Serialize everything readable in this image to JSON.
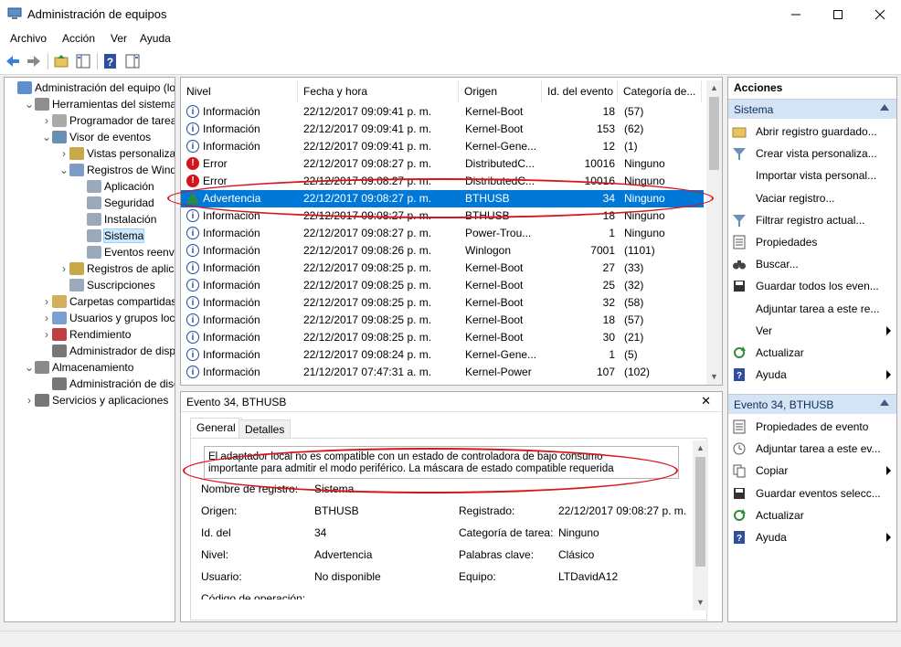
{
  "window": {
    "title": "Administración de equipos",
    "controls": [
      "minimize",
      "maximize",
      "close"
    ]
  },
  "menu": [
    "Archivo",
    "Acción",
    "Ver",
    "Ayuda"
  ],
  "tree": [
    {
      "label": "Administración del equipo (loc",
      "depth": 0,
      "exp": ""
    },
    {
      "label": "Herramientas del sistema",
      "depth": 1,
      "exp": "v"
    },
    {
      "label": "Programador de tareas",
      "depth": 2,
      "exp": ">"
    },
    {
      "label": "Visor de eventos",
      "depth": 2,
      "exp": "v"
    },
    {
      "label": "Vistas personalizada",
      "depth": 3,
      "exp": ">"
    },
    {
      "label": "Registros de Windov",
      "depth": 3,
      "exp": "v"
    },
    {
      "label": "Aplicación",
      "depth": 4,
      "exp": ""
    },
    {
      "label": "Seguridad",
      "depth": 4,
      "exp": ""
    },
    {
      "label": "Instalación",
      "depth": 4,
      "exp": ""
    },
    {
      "label": "Sistema",
      "depth": 4,
      "exp": "",
      "selected": true
    },
    {
      "label": "Eventos reenviac",
      "depth": 4,
      "exp": ""
    },
    {
      "label": "Registros de aplicac",
      "depth": 3,
      "exp": ">"
    },
    {
      "label": "Suscripciones",
      "depth": 3,
      "exp": ""
    },
    {
      "label": "Carpetas compartidas",
      "depth": 2,
      "exp": ">"
    },
    {
      "label": "Usuarios y grupos locale",
      "depth": 2,
      "exp": ">"
    },
    {
      "label": "Rendimiento",
      "depth": 2,
      "exp": ">"
    },
    {
      "label": "Administrador de dispo",
      "depth": 2,
      "exp": ""
    },
    {
      "label": "Almacenamiento",
      "depth": 1,
      "exp": "v"
    },
    {
      "label": "Administración de disco",
      "depth": 2,
      "exp": ""
    },
    {
      "label": "Servicios y aplicaciones",
      "depth": 1,
      "exp": ">"
    }
  ],
  "events_table": {
    "columns": [
      "Nivel",
      "Fecha y hora",
      "Origen",
      "Id. del evento",
      "Categoría de..."
    ],
    "rows": [
      {
        "level": "Información",
        "kind": "info",
        "date": "22/12/2017 09:09:41 p. m.",
        "source": "Kernel-Boot",
        "id": "18",
        "cat": "(57)"
      },
      {
        "level": "Información",
        "kind": "info",
        "date": "22/12/2017 09:09:41 p. m.",
        "source": "Kernel-Boot",
        "id": "153",
        "cat": "(62)"
      },
      {
        "level": "Información",
        "kind": "info",
        "date": "22/12/2017 09:09:41 p. m.",
        "source": "Kernel-Gene...",
        "id": "12",
        "cat": "(1)"
      },
      {
        "level": "Error",
        "kind": "error",
        "date": "22/12/2017 09:08:27 p. m.",
        "source": "DistributedC...",
        "id": "10016",
        "cat": "Ninguno"
      },
      {
        "level": "Error",
        "kind": "error",
        "date": "22/12/2017 09:08:27 p. m.",
        "source": "DistributedC...",
        "id": "10016",
        "cat": "Ninguno"
      },
      {
        "level": "Advertencia",
        "kind": "warn",
        "date": "22/12/2017 09:08:27 p. m.",
        "source": "BTHUSB",
        "id": "34",
        "cat": "Ninguno",
        "selected": true
      },
      {
        "level": "Información",
        "kind": "info",
        "date": "22/12/2017 09:08:27 p. m.",
        "source": "BTHUSB",
        "id": "18",
        "cat": "Ninguno"
      },
      {
        "level": "Información",
        "kind": "info",
        "date": "22/12/2017 09:08:27 p. m.",
        "source": "Power-Trou...",
        "id": "1",
        "cat": "Ninguno"
      },
      {
        "level": "Información",
        "kind": "info",
        "date": "22/12/2017 09:08:26 p. m.",
        "source": "Winlogon",
        "id": "7001",
        "cat": "(1101)"
      },
      {
        "level": "Información",
        "kind": "info",
        "date": "22/12/2017 09:08:25 p. m.",
        "source": "Kernel-Boot",
        "id": "27",
        "cat": "(33)"
      },
      {
        "level": "Información",
        "kind": "info",
        "date": "22/12/2017 09:08:25 p. m.",
        "source": "Kernel-Boot",
        "id": "25",
        "cat": "(32)"
      },
      {
        "level": "Información",
        "kind": "info",
        "date": "22/12/2017 09:08:25 p. m.",
        "source": "Kernel-Boot",
        "id": "32",
        "cat": "(58)"
      },
      {
        "level": "Información",
        "kind": "info",
        "date": "22/12/2017 09:08:25 p. m.",
        "source": "Kernel-Boot",
        "id": "18",
        "cat": "(57)"
      },
      {
        "level": "Información",
        "kind": "info",
        "date": "22/12/2017 09:08:25 p. m.",
        "source": "Kernel-Boot",
        "id": "30",
        "cat": "(21)"
      },
      {
        "level": "Información",
        "kind": "info",
        "date": "22/12/2017 09:08:24 p. m.",
        "source": "Kernel-Gene...",
        "id": "1",
        "cat": "(5)"
      },
      {
        "level": "Información",
        "kind": "info",
        "date": "21/12/2017 07:47:31 a. m.",
        "source": "Kernel-Power",
        "id": "107",
        "cat": "(102)"
      }
    ]
  },
  "detail": {
    "header": "Evento 34, BTHUSB",
    "close": "✕",
    "tabs": [
      "General",
      "Detalles"
    ],
    "message_line1": "El adaptador local no es compatible con un estado de controladora de bajo consumo",
    "message_line2": "importante para admitir el modo periférico. La máscara de estado compatible requerida",
    "props": {
      "log_name_label": "Nombre de registro:",
      "log_name": "Sistema",
      "source_label": "Origen:",
      "source": "BTHUSB",
      "logged_label": "Registrado:",
      "logged": "22/12/2017 09:08:27 p. m.",
      "id_label": "Id. del",
      "id": "34",
      "task_label": "Categoría de tarea:",
      "task": "Ninguno",
      "level_label": "Nivel:",
      "level": "Advertencia",
      "keywords_label": "Palabras clave:",
      "keywords": "Clásico",
      "user_label": "Usuario:",
      "user": "No disponible",
      "computer_label": "Equipo:",
      "computer": "LTDavidA12",
      "opcode_label": "Código de operación:"
    }
  },
  "actions": {
    "title": "Acciones",
    "section1": "Sistema",
    "items1": [
      {
        "label": "Abrir registro guardado...",
        "icon": "folder-open-icon",
        "sub": false
      },
      {
        "label": "Crear vista personaliza...",
        "icon": "filter-new-icon",
        "sub": false
      },
      {
        "label": "Importar vista personal...",
        "icon": "",
        "sub": false
      },
      {
        "label": "Vaciar registro...",
        "icon": "",
        "sub": false
      },
      {
        "label": "Filtrar registro actual...",
        "icon": "filter-icon",
        "sub": false
      },
      {
        "label": "Propiedades",
        "icon": "properties-icon",
        "sub": false
      },
      {
        "label": "Buscar...",
        "icon": "binoculars-icon",
        "sub": false
      },
      {
        "label": "Guardar todos los even...",
        "icon": "save-icon",
        "sub": false
      },
      {
        "label": "Adjuntar tarea a este re...",
        "icon": "",
        "sub": false
      },
      {
        "label": "Ver",
        "icon": "",
        "sub": true
      },
      {
        "label": "Actualizar",
        "icon": "refresh-icon",
        "sub": false
      },
      {
        "label": "Ayuda",
        "icon": "help-icon",
        "sub": true
      }
    ],
    "section2": "Evento 34, BTHUSB",
    "items2": [
      {
        "label": "Propiedades de evento",
        "icon": "properties-icon",
        "sub": false
      },
      {
        "label": "Adjuntar tarea a este ev...",
        "icon": "task-icon",
        "sub": false
      },
      {
        "label": "Copiar",
        "icon": "copy-icon",
        "sub": true
      },
      {
        "label": "Guardar eventos selecc...",
        "icon": "save-icon",
        "sub": false
      },
      {
        "label": "Actualizar",
        "icon": "refresh-icon",
        "sub": false
      },
      {
        "label": "Ayuda",
        "icon": "help-icon",
        "sub": true
      }
    ]
  },
  "colors": {
    "selection": "#0078d7",
    "section_bg": "#d4e4f5",
    "annotation": "#d9141c"
  }
}
